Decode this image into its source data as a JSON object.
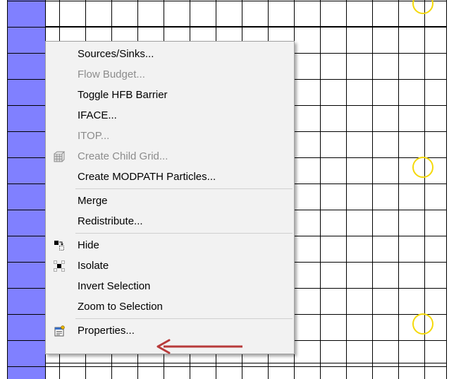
{
  "colors": {
    "grid_line": "#000000",
    "boundary_cells": "#8080ff",
    "well_marker": "#f5d90a",
    "menu_background": "#f2f2f2",
    "disabled_text": "#8c8c8c",
    "annotation_arrow": "#b83a3a"
  },
  "grid": {
    "wells": [
      {
        "icon": "well-circle"
      },
      {
        "icon": "well-circle"
      },
      {
        "icon": "well-circle"
      }
    ]
  },
  "context_menu": {
    "groups": [
      [
        {
          "label": "Sources/Sinks...",
          "enabled": true
        },
        {
          "label": "Flow Budget...",
          "enabled": false
        },
        {
          "label": "Toggle HFB Barrier",
          "enabled": true
        },
        {
          "label": "IFACE...",
          "enabled": true
        },
        {
          "label": "ITOP...",
          "enabled": false
        },
        {
          "label": "Create Child Grid...",
          "enabled": false,
          "icon": "child-grid-icon"
        },
        {
          "label": "Create MODPATH Particles...",
          "enabled": true
        }
      ],
      [
        {
          "label": "Merge",
          "enabled": true
        },
        {
          "label": "Redistribute...",
          "enabled": true
        }
      ],
      [
        {
          "label": "Hide",
          "enabled": true,
          "icon": "hide-icon"
        },
        {
          "label": "Isolate",
          "enabled": true,
          "icon": "isolate-icon"
        },
        {
          "label": "Invert Selection",
          "enabled": true
        },
        {
          "label": "Zoom to Selection",
          "enabled": true
        }
      ],
      [
        {
          "label": "Properties...",
          "enabled": true,
          "icon": "properties-icon",
          "annotated": true
        }
      ]
    ]
  }
}
